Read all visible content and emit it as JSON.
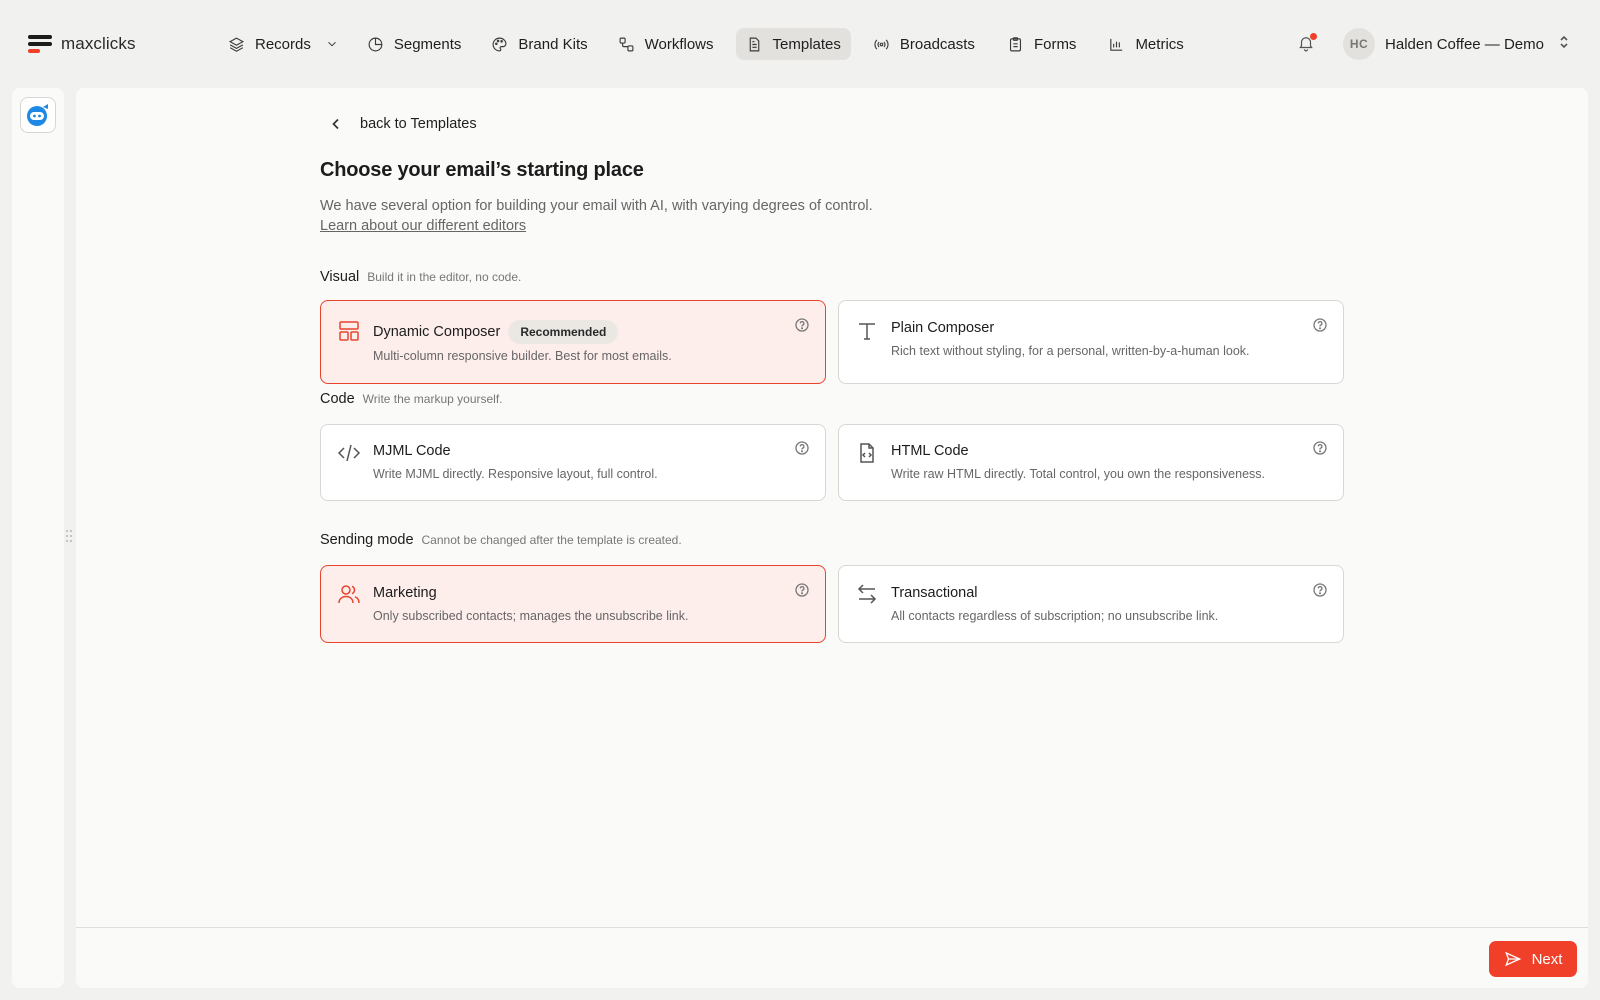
{
  "app": {
    "logo_text": "maxclicks"
  },
  "nav": {
    "records": "Records",
    "segments": "Segments",
    "brand_kits": "Brand Kits",
    "workflows": "Workflows",
    "templates": "Templates",
    "broadcasts": "Broadcasts",
    "forms": "Forms",
    "metrics": "Metrics",
    "active": "Templates"
  },
  "account": {
    "initials": "HC",
    "name": "Halden Coffee — Demo",
    "has_notification": true
  },
  "page": {
    "back_label": "back to Templates",
    "title": "Choose your email’s starting place",
    "subtitle": "We have several option for building your email with AI, with varying degrees of control.",
    "learn_link": "Learn about our different editors"
  },
  "sections": {
    "visual": {
      "name": "Visual",
      "hint": "Build it in the editor, no code."
    },
    "code": {
      "name": "Code",
      "hint": "Write the markup yourself."
    },
    "sending": {
      "name": "Sending mode",
      "hint": "Cannot be changed after the template is created."
    }
  },
  "cards": {
    "dynamic": {
      "title": "Dynamic Composer",
      "badge": "Recommended",
      "desc": "Multi-column responsive builder. Best for most emails.",
      "selected": true,
      "icon": "layout-icon"
    },
    "plain": {
      "title": "Plain Composer",
      "desc": "Rich text without styling, for a personal, written-by-a-human look.",
      "selected": false,
      "icon": "text-icon"
    },
    "mjml": {
      "title": "MJML Code",
      "desc": "Write MJML directly. Responsive layout, full control.",
      "selected": false,
      "icon": "code-icon"
    },
    "html": {
      "title": "HTML Code",
      "desc": "Write raw HTML directly. Total control, you own the responsiveness.",
      "selected": false,
      "icon": "file-code-icon"
    },
    "marketing": {
      "title": "Marketing",
      "desc": "Only subscribed contacts; manages the unsubscribe link.",
      "selected": true,
      "icon": "users-icon"
    },
    "transactional": {
      "title": "Transactional",
      "desc": "All contacts regardless of subscription; no unsubscribe link.",
      "selected": false,
      "icon": "arrows-swap-icon"
    }
  },
  "footer": {
    "next_label": "Next"
  },
  "colors": {
    "accent": "#f0402a",
    "selected_bg": "#fdeeec",
    "active_nav_bg": "#e3e1dd"
  }
}
